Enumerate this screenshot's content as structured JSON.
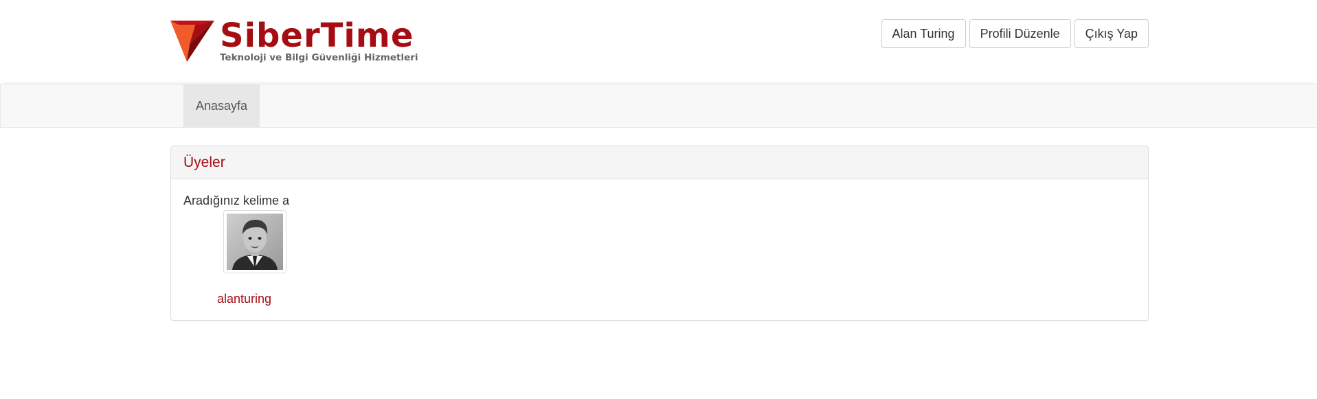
{
  "header": {
    "brand_name": "SiberTime",
    "tagline": "Teknoloji ve Bilgi Güvenliği Hizmetleri",
    "logo_icon": "shield-triangle-logo",
    "buttons": {
      "user": "Alan Turing",
      "edit_profile": "Profili Düzenle",
      "logout": "Çıkış Yap"
    }
  },
  "nav": {
    "items": [
      {
        "label": "Anasayfa",
        "active": true
      }
    ]
  },
  "panel": {
    "title": "Üyeler",
    "search_text": "Aradığınız kelime a",
    "members": [
      {
        "username": "alanturing",
        "avatar": "member-photo-icon"
      }
    ]
  },
  "colors": {
    "brand": "#a50d12",
    "logo_orange": "#f15a29",
    "logo_dark": "#7a0a0e"
  }
}
